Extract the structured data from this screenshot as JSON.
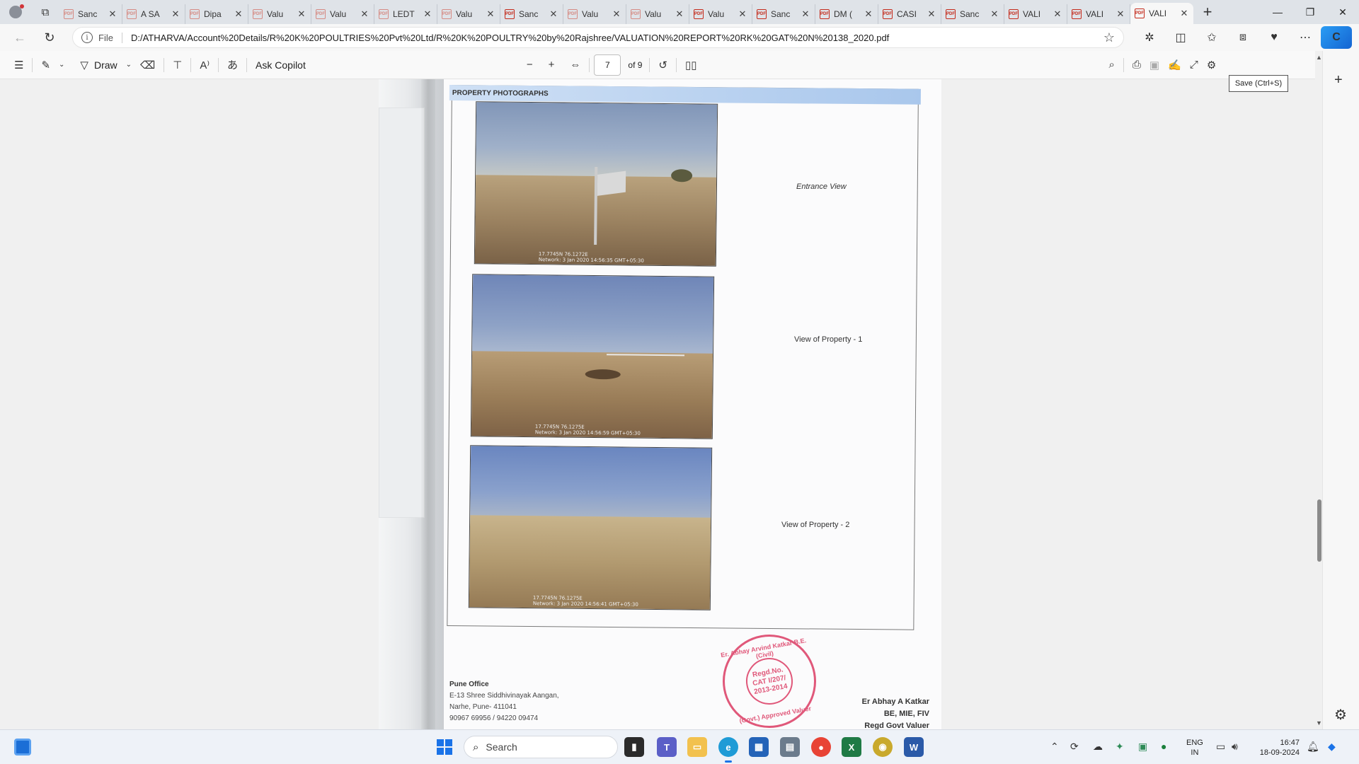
{
  "tabs": [
    {
      "label": "Sanc",
      "icon": "pdf-icon"
    },
    {
      "label": "A SA",
      "icon": "pdf-icon"
    },
    {
      "label": "Dipa",
      "icon": "pdf-icon"
    },
    {
      "label": "Valu",
      "icon": "pdf-icon"
    },
    {
      "label": "Valu",
      "icon": "pdf-icon"
    },
    {
      "label": "LEDT",
      "icon": "pdf-icon"
    },
    {
      "label": "Valu",
      "icon": "pdf-icon"
    },
    {
      "label": "Sanc",
      "icon": "pdf-icon"
    },
    {
      "label": "Valu",
      "icon": "pdf-icon"
    },
    {
      "label": "Valu",
      "icon": "pdf-icon"
    },
    {
      "label": "Valu",
      "icon": "pdf-icon"
    },
    {
      "label": "Sanc",
      "icon": "pdf-icon"
    },
    {
      "label": "DM (",
      "icon": "pdf-icon"
    },
    {
      "label": "CASI",
      "icon": "pdf-icon"
    },
    {
      "label": "Sanc",
      "icon": "pdf-icon"
    },
    {
      "label": "VALI",
      "icon": "pdf-icon"
    },
    {
      "label": "VALI",
      "icon": "pdf-icon"
    },
    {
      "label": "VALI",
      "icon": "pdf-icon",
      "active": true
    }
  ],
  "address": {
    "protocol": "File",
    "url": "D:/ATHARVA/Account%20Details/R%20K%20POULTRIES%20Pvt%20Ltd/R%20K%20POULTRY%20by%20Rajshree/VALUATION%20REPORT%20RK%20GAT%20N%20138_2020.pdf"
  },
  "pdf_toolbar": {
    "draw_label": "Draw",
    "ask_copilot_label": "Ask Copilot",
    "current_page": "7",
    "page_total": "of 9",
    "save_tooltip": "Save (Ctrl+S)"
  },
  "document": {
    "section_header": "PROPERTY PHOTOGRAPHS",
    "photos": [
      {
        "caption": "Entrance View",
        "stamp_line1": "17.7745N 76.1272E",
        "stamp_line2": "Network: 3 Jan 2020 14:56:35 GMT+05:30"
      },
      {
        "caption": "View of Property  - 1",
        "stamp_line1": "17.7745N 76.1275E",
        "stamp_line2": "Network: 3 Jan 2020 14:56:59 GMT+05:30"
      },
      {
        "caption": "View of Property - 2",
        "stamp_line1": "17.7745N 76.1275E",
        "stamp_line2": "Network: 3 Jan 2020 14:56:41 GMT+05:30"
      }
    ],
    "office": {
      "title": "Pune Office",
      "line1": "E-13 Shree Siddhivinayak Aangan,",
      "line2": "Narhe, Pune- 411041",
      "line3": "90967 69956 / 94220 09474"
    },
    "seal": {
      "top": "Er. Abhay Arvind Katkar B.E. (Civil)",
      "center1": "Regd.No.",
      "center2": "CAT I/207/",
      "center3": "2013-2014",
      "bottom": "(Govt.) Approved Valuer"
    },
    "signer": {
      "name": "Er Abhay A Katkar",
      "degrees": "BE, MIE, FIV",
      "role": "Regd Govt Valuer"
    }
  },
  "taskbar": {
    "search_placeholder": "Search",
    "language_line1": "ENG",
    "language_line2": "IN",
    "time": "16:47",
    "date": "18-09-2024"
  },
  "colors": {
    "accent": "#1a73e8",
    "pdf_red": "#c42b1c",
    "seal_pink": "#e0587a"
  }
}
